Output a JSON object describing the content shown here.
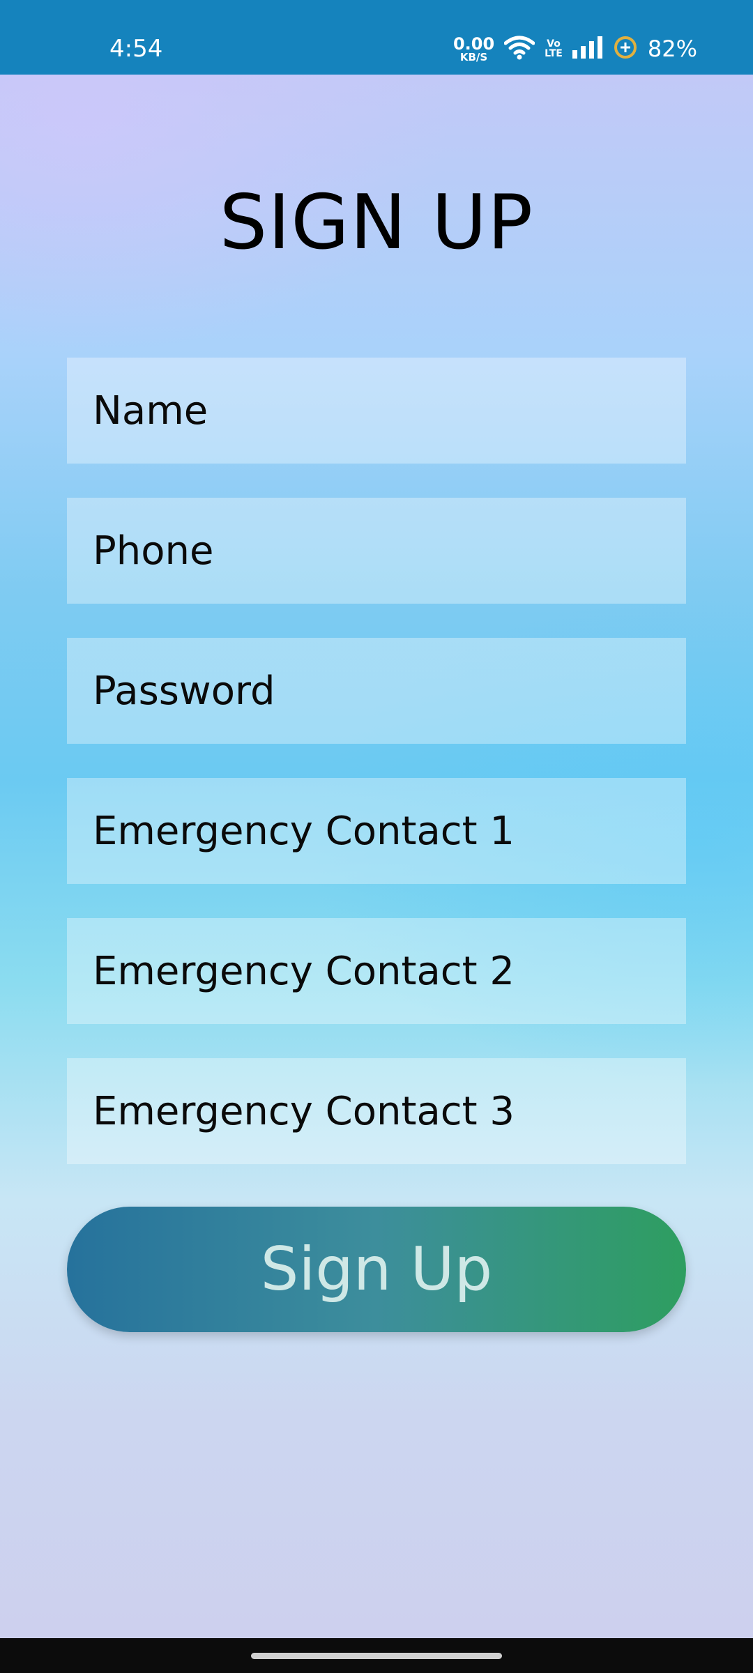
{
  "status_bar": {
    "time": "4:54",
    "net_speed_value": "0.00",
    "net_speed_unit": "KB/S",
    "volte_top": "Vo",
    "volte_bottom": "LTE",
    "battery": "82%",
    "icons": [
      "wifi-icon",
      "signal-icon",
      "battery-saver-icon"
    ]
  },
  "form": {
    "title": "SIGN UP",
    "fields": [
      {
        "placeholder": "Name"
      },
      {
        "placeholder": "Phone"
      },
      {
        "placeholder": "Password"
      },
      {
        "placeholder": "Emergency Contact 1"
      },
      {
        "placeholder": "Emergency Contact 2"
      },
      {
        "placeholder": "Emergency Contact 3"
      }
    ],
    "submit_label": "Sign Up"
  },
  "colors": {
    "status_bar": "#1583bd",
    "button_start": "#26729c",
    "button_end": "#2e9e60",
    "button_text": "#cfe8e6"
  }
}
